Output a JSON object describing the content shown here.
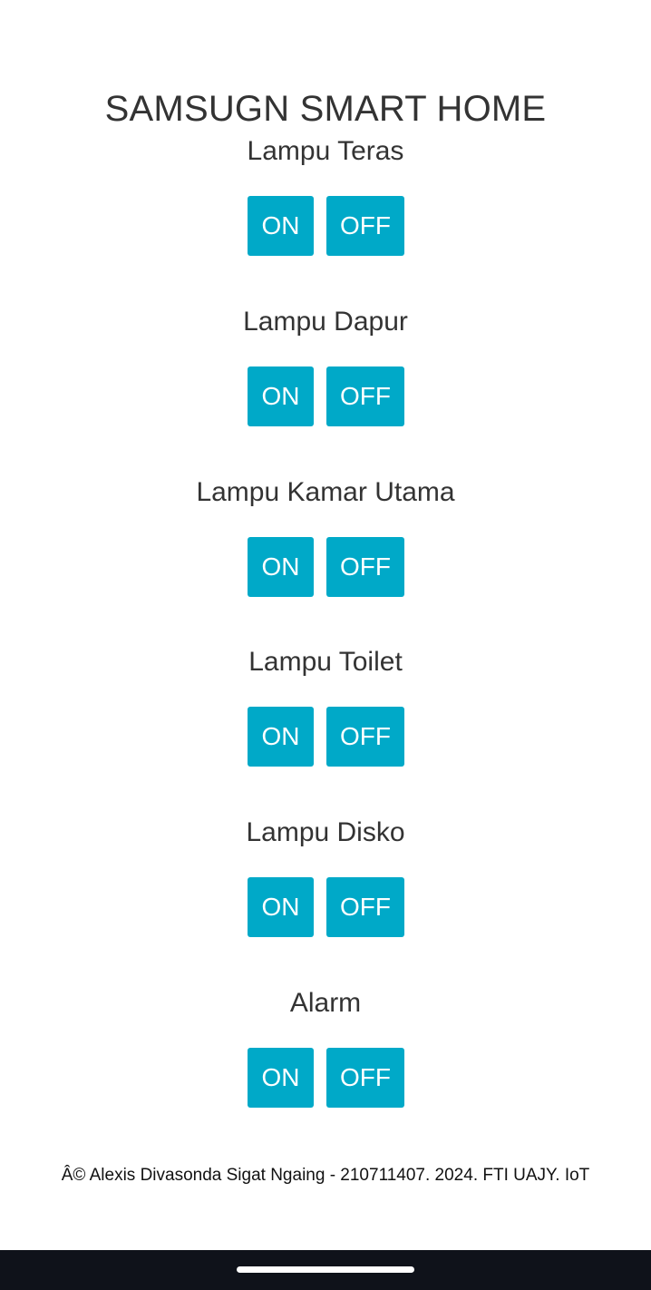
{
  "page": {
    "title": "SAMSUGN SMART HOME"
  },
  "devices": [
    {
      "name": "Lampu Teras",
      "on_label": "ON",
      "off_label": "OFF"
    },
    {
      "name": "Lampu Dapur",
      "on_label": "ON",
      "off_label": "OFF"
    },
    {
      "name": "Lampu Kamar Utama",
      "on_label": "ON",
      "off_label": "OFF"
    },
    {
      "name": "Lampu Toilet",
      "on_label": "ON",
      "off_label": "OFF"
    },
    {
      "name": "Lampu Disko",
      "on_label": "ON",
      "off_label": "OFF"
    },
    {
      "name": "Alarm",
      "on_label": "ON",
      "off_label": "OFF"
    }
  ],
  "footer": {
    "text": "Â© Alexis Divasonda Sigat Ngaing - 210711407. 2024. FTI UAJY. IoT"
  },
  "colors": {
    "button_bg": "#00a9c8",
    "text": "#333333",
    "nav_bar": "#0f121a"
  }
}
